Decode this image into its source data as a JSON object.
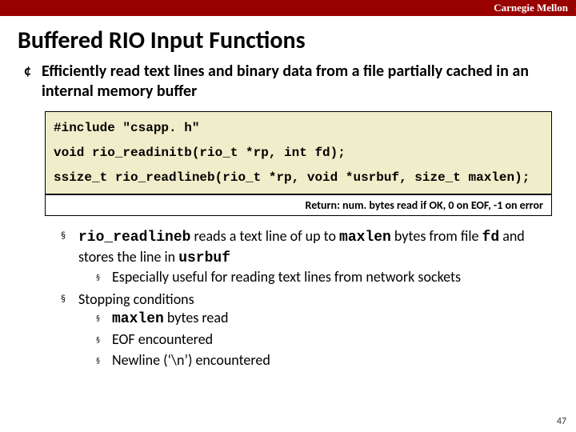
{
  "header": {
    "brand": "Carnegie Mellon"
  },
  "slide": {
    "title": "Buffered RIO Input Functions",
    "intro": "Efficiently read text lines and binary data from a file partially cached in an internal memory buffer",
    "code": {
      "line1": "#include \"csapp. h\"",
      "line2": "void rio_readinitb(rio_t *rp, int fd);",
      "line3": "ssize_t rio_readlineb(rio_t *rp, void *usrbuf, size_t maxlen);"
    },
    "return_note": "Return: num. bytes read if OK, 0 on EOF, -1 on error",
    "detail": {
      "fn": "rio_readlineb",
      "mid1": " reads a text line of up to ",
      "maxlen": "maxlen",
      "mid2": " bytes from file ",
      "fd": "fd",
      "mid3": " and stores the line in ",
      "usrbuf": "usrbuf",
      "sub1": "Especially useful for reading text lines from network sockets",
      "stop_label": "Stopping conditions",
      "stop1a": "maxlen",
      "stop1b": " bytes read",
      "stop2": "EOF encountered",
      "stop3": "Newline (‘\\n’) encountered"
    },
    "page_number": "47"
  }
}
